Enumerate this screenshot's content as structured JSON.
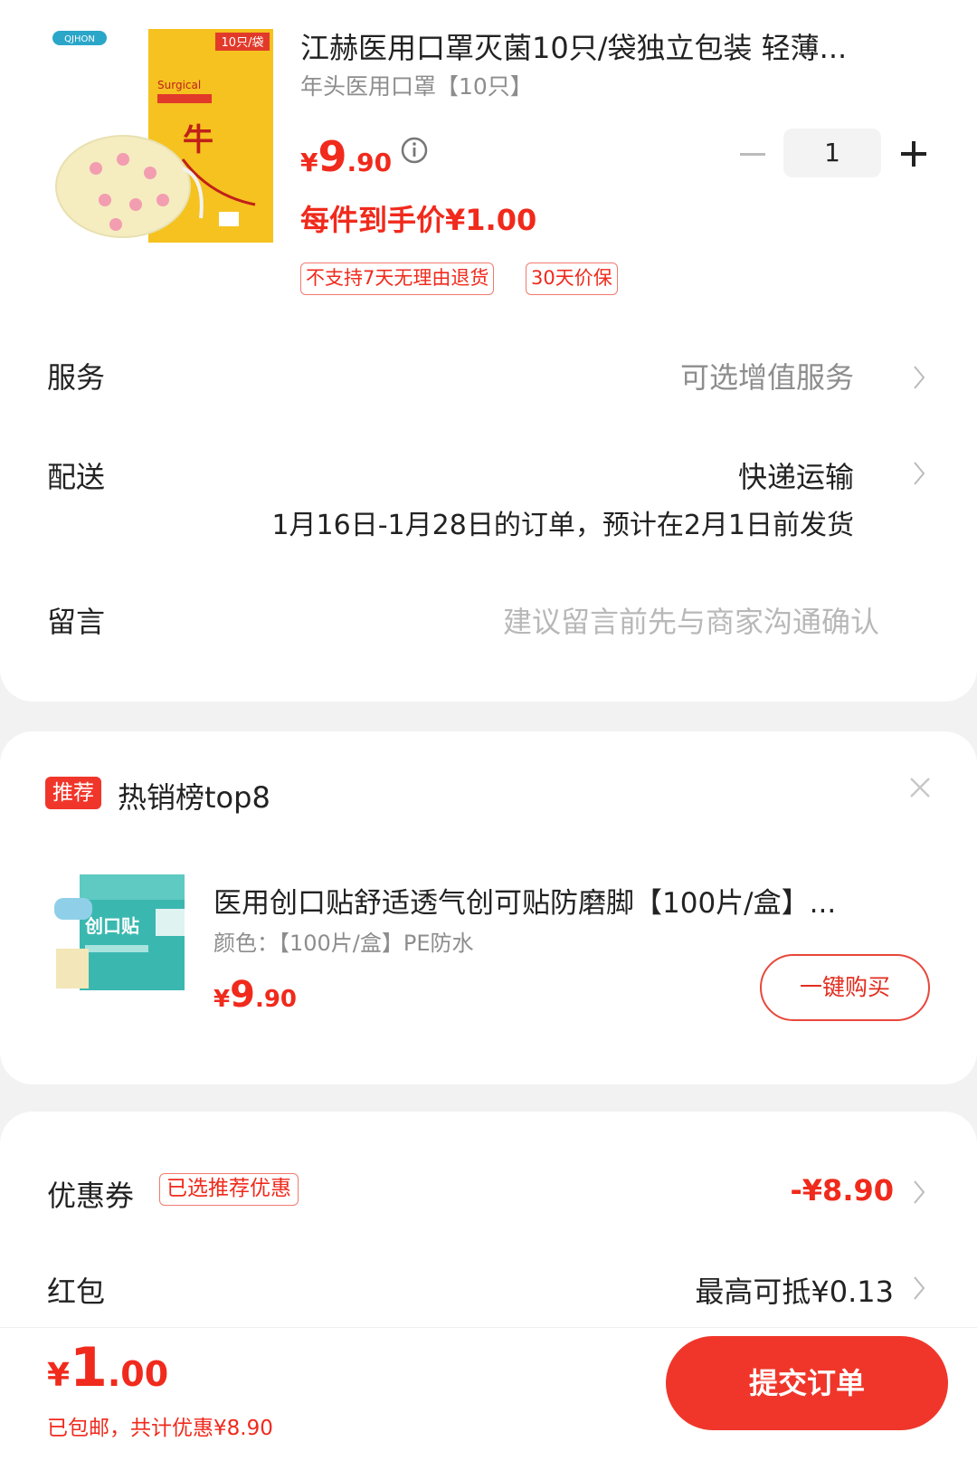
{
  "product": {
    "title": "江赫医用口罩灭菌10只/袋独立包装 轻薄...",
    "spec": "年头医用口罩【10只】",
    "price": {
      "currency": "¥",
      "integer": "9",
      "decimal": ".90"
    },
    "final_price": "每件到手价¥1.00",
    "quantity": "1",
    "tags": [
      "不支持7天无理由退货",
      "30天价保"
    ],
    "image_icon": "mask-package-image",
    "image_text": {
      "brand": "QJHON",
      "count": "10只/袋",
      "label": "Surgical",
      "char": "牛"
    }
  },
  "rows": {
    "service": {
      "label": "服务",
      "value": "可选增值服务"
    },
    "delivery": {
      "label": "配送",
      "value": "快递运输",
      "note": "1月16日-1月28日的订单，预计在2月1日前发货"
    },
    "message": {
      "label": "留言",
      "placeholder": "建议留言前先与商家沟通确认"
    }
  },
  "recommend": {
    "badge": "推荐",
    "title": "热销榜top8",
    "item": {
      "name": "医用创口贴舒适透气创可贴防磨脚【100片/盒】...",
      "spec": "颜色：【100片/盒】PE防水",
      "price": {
        "currency": "¥",
        "integer": "9",
        "decimal": ".90"
      },
      "buy_label": "一键购买",
      "image_icon": "bandage-box-image",
      "image_text": "创口贴"
    }
  },
  "discounts": {
    "coupon": {
      "label": "优惠券",
      "tag": "已选推荐优惠",
      "value": "-¥8.90"
    },
    "red_packet": {
      "label": "红包",
      "value": "最高可抵¥0.13"
    }
  },
  "bottom": {
    "total": {
      "currency": "¥",
      "integer": "1",
      "decimal": ".00"
    },
    "note": "已包邮，共计优惠¥8.90",
    "submit_label": "提交订单"
  },
  "colors": {
    "accent": "#f0362a",
    "price": "#f02a1c",
    "muted": "#8d8d8d"
  }
}
